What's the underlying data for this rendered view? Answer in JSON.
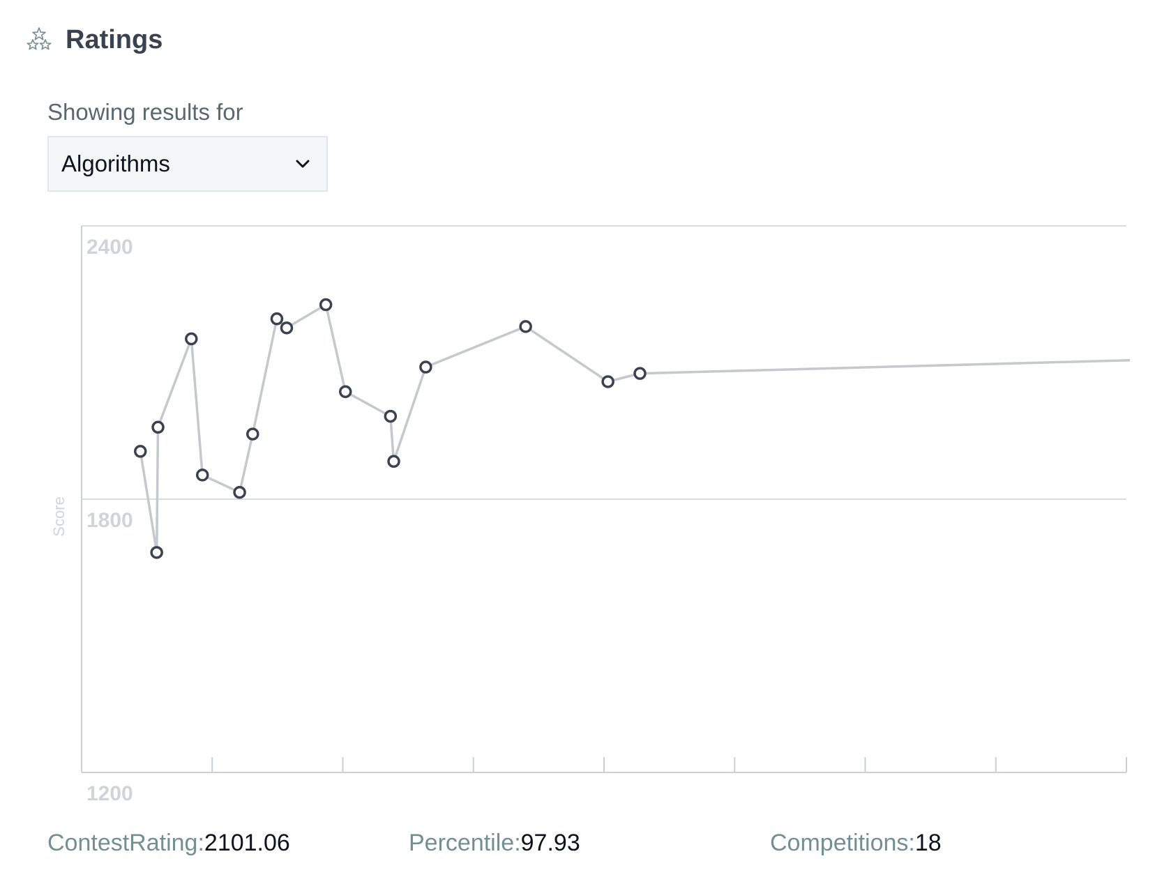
{
  "header": {
    "title": "Ratings",
    "icon": "stars-icon"
  },
  "filter": {
    "label": "Showing results for",
    "selected": "Algorithms",
    "icon": "chevron-down-icon"
  },
  "chart_data": {
    "type": "line",
    "title": "",
    "xlabel": "",
    "ylabel": "Score",
    "ylim": [
      1200,
      2400
    ],
    "yticks": [
      2400,
      1800,
      1200
    ],
    "x_ticks_count": 8,
    "grid": true,
    "legend": "none",
    "line_color": "#c5c8cd",
    "marker_color": "#39424e",
    "series": [
      {
        "x": [
          0.9,
          1.15,
          1.17,
          1.68,
          1.85,
          2.42,
          2.62,
          2.99,
          3.14,
          3.74,
          4.04,
          4.73,
          4.78,
          5.27,
          6.8,
          8.06,
          8.55,
          16.3
        ],
        "values": [
          1905,
          1683,
          1958,
          2152,
          1853,
          1815,
          1943,
          2196,
          2176,
          2227,
          2036,
          1982,
          1883,
          2090,
          2179,
          2058,
          2076,
          2106
        ]
      }
    ]
  },
  "stats": [
    {
      "label": "ContestRating:",
      "value": "2101.06"
    },
    {
      "label": "Percentile:",
      "value": "97.93"
    },
    {
      "label": "Competitions:",
      "value": "18"
    }
  ]
}
